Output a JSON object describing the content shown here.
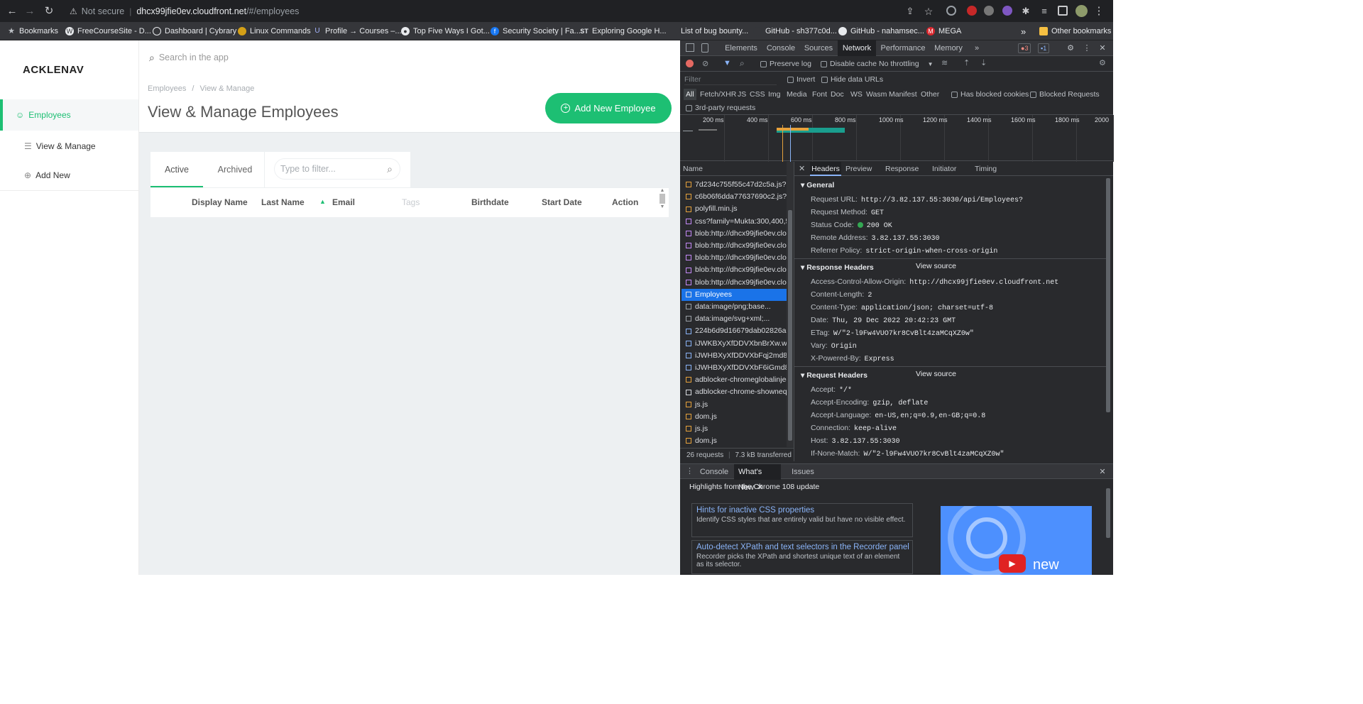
{
  "browser": {
    "security_label": "Not secure",
    "url_host": "dhcx99jfie0ev.cloudfront.net",
    "url_path": "/#/employees",
    "bookmarks": [
      {
        "label": "Bookmarks",
        "icon": "star-icon"
      },
      {
        "label": "FreeCourseSite - D...",
        "icon": "wordpress-icon"
      },
      {
        "label": "Dashboard | Cybrary",
        "icon": "cybrary-icon"
      },
      {
        "label": "Linux Commands",
        "icon": "linux-icon"
      },
      {
        "label": "Profile → Courses –...",
        "icon": "udemy-icon"
      },
      {
        "label": "Top Five Ways I Got...",
        "icon": "medium-icon"
      },
      {
        "label": "Security Society | Fa...",
        "icon": "facebook-icon"
      },
      {
        "label": "Exploring Google H...",
        "icon": "st-icon"
      },
      {
        "label": "List of bug bounty...",
        "icon": "page-icon"
      },
      {
        "label": "GitHub - sh377c0d...",
        "icon": "github-icon"
      },
      {
        "label": "GitHub - nahamsec...",
        "icon": "github-icon"
      },
      {
        "label": "MEGA",
        "icon": "mega-icon"
      }
    ],
    "other_bookmarks": "Other bookmarks"
  },
  "app": {
    "logo": "ACKLENAV",
    "search_placeholder": "Search in the app",
    "sidebar": [
      {
        "label": "Employees",
        "icon": "user-icon",
        "active": true
      },
      {
        "label": "View & Manage",
        "icon": "list-icon",
        "active": false
      },
      {
        "label": "Add New",
        "icon": "plus-circle-icon",
        "active": false
      }
    ],
    "breadcrumb": [
      "Employees",
      "View & Manage"
    ],
    "breadcrumb_sep": "/",
    "page_title": "View & Manage Employees",
    "add_button": "Add New Employee",
    "tabs": [
      "Active",
      "Archived"
    ],
    "filter_placeholder": "Type to filter...",
    "columns": [
      "Display Name",
      "Last Name",
      "Email",
      "Tags",
      "Birthdate",
      "Start Date",
      "Action"
    ],
    "accent": "#1dbf73"
  },
  "devtools": {
    "tabs": [
      "Elements",
      "Console",
      "Sources",
      "Network",
      "Performance",
      "Memory"
    ],
    "active_tab": "Network",
    "error_count": "3",
    "message_count": "1",
    "preserve_log": "Preserve log",
    "disable_cache": "Disable cache",
    "throttling": "No throttling",
    "filter_placeholder": "Filter",
    "invert": "Invert",
    "hide_data_urls": "Hide data URLs",
    "type_filters": [
      "All",
      "Fetch/XHR",
      "JS",
      "CSS",
      "Img",
      "Media",
      "Font",
      "Doc",
      "WS",
      "Wasm",
      "Manifest",
      "Other"
    ],
    "has_blocked_cookies": "Has blocked cookies",
    "blocked_requests": "Blocked Requests",
    "third_party": "3rd-party requests",
    "timeline_labels": [
      "200 ms",
      "400 ms",
      "600 ms",
      "800 ms",
      "1000 ms",
      "1200 ms",
      "1400 ms",
      "1600 ms",
      "1800 ms",
      "2000"
    ],
    "name_header": "Name",
    "requests": [
      "7d234c755f55c47d2c5a.js?83...",
      "c6b06f6dda77637690c2.js?83...",
      "polyfill.min.js",
      "css?family=Mukta:300,400,50...",
      "blob:http://dhcx99jfie0ev.clou...",
      "blob:http://dhcx99jfie0ev.clou...",
      "blob:http://dhcx99jfie0ev.clou...",
      "blob:http://dhcx99jfie0ev.clou...",
      "blob:http://dhcx99jfie0ev.clou...",
      "Employees",
      "data:image/png;base...",
      "data:image/svg+xml;...",
      "224b6d9d16679dab02826a2a...",
      "iJWKBXyXfDDVXbnBrXw.woff...",
      "iJWHBXyXfDDVXbFqj2md8W...",
      "iJWHBXyXfDDVXbF6iGmd8W...",
      "adblocker-chromeglobalinjec...",
      "adblocker-chrome-showneqJ...",
      "js.js",
      "dom.js",
      "js.js",
      "dom.js"
    ],
    "selected_request": "Employees",
    "status_requests": "26 requests",
    "status_transferred": "7.3 kB transferred",
    "detail_tabs": [
      "Headers",
      "Preview",
      "Response",
      "Initiator",
      "Timing"
    ],
    "general_title": "General",
    "general": [
      {
        "k": "Request URL:",
        "v": "http://3.82.137.55:3030/api/Employees?"
      },
      {
        "k": "Request Method:",
        "v": "GET"
      },
      {
        "k": "Status Code:",
        "v": "200 OK"
      },
      {
        "k": "Remote Address:",
        "v": "3.82.137.55:3030"
      },
      {
        "k": "Referrer Policy:",
        "v": "strict-origin-when-cross-origin"
      }
    ],
    "response_title": "Response Headers",
    "view_source": "View source",
    "response": [
      {
        "k": "Access-Control-Allow-Origin:",
        "v": "http://dhcx99jfie0ev.cloudfront.net"
      },
      {
        "k": "Content-Length:",
        "v": "2"
      },
      {
        "k": "Content-Type:",
        "v": "application/json; charset=utf-8"
      },
      {
        "k": "Date:",
        "v": "Thu, 29 Dec 2022 20:42:23 GMT"
      },
      {
        "k": "ETag:",
        "v": "W/\"2-l9Fw4VUO7kr8CvBlt4zaMCqXZ0w\""
      },
      {
        "k": "Vary:",
        "v": "Origin"
      },
      {
        "k": "X-Powered-By:",
        "v": "Express"
      }
    ],
    "request_title": "Request Headers",
    "request": [
      {
        "k": "Accept:",
        "v": "*/*"
      },
      {
        "k": "Accept-Encoding:",
        "v": "gzip, deflate"
      },
      {
        "k": "Accept-Language:",
        "v": "en-US,en;q=0.9,en-GB;q=0.8"
      },
      {
        "k": "Connection:",
        "v": "keep-alive"
      },
      {
        "k": "Host:",
        "v": "3.82.137.55:3030"
      },
      {
        "k": "If-None-Match:",
        "v": "W/\"2-l9Fw4VUO7kr8CvBlt4zaMCqXZ0w\""
      }
    ],
    "drawer_tabs": [
      "Console",
      "What's New",
      "Issues"
    ],
    "drawer_heading": "Highlights from the Chrome 108 update",
    "cards": [
      {
        "title": "Hints for inactive CSS properties",
        "body": "Identify CSS styles that are entirely valid but have no visible effect."
      },
      {
        "title": "Auto-detect XPath and text selectors in the Recorder panel",
        "body": "Recorder picks the XPath and shortest unique text of an element as its selector."
      }
    ],
    "video_label": "new"
  }
}
